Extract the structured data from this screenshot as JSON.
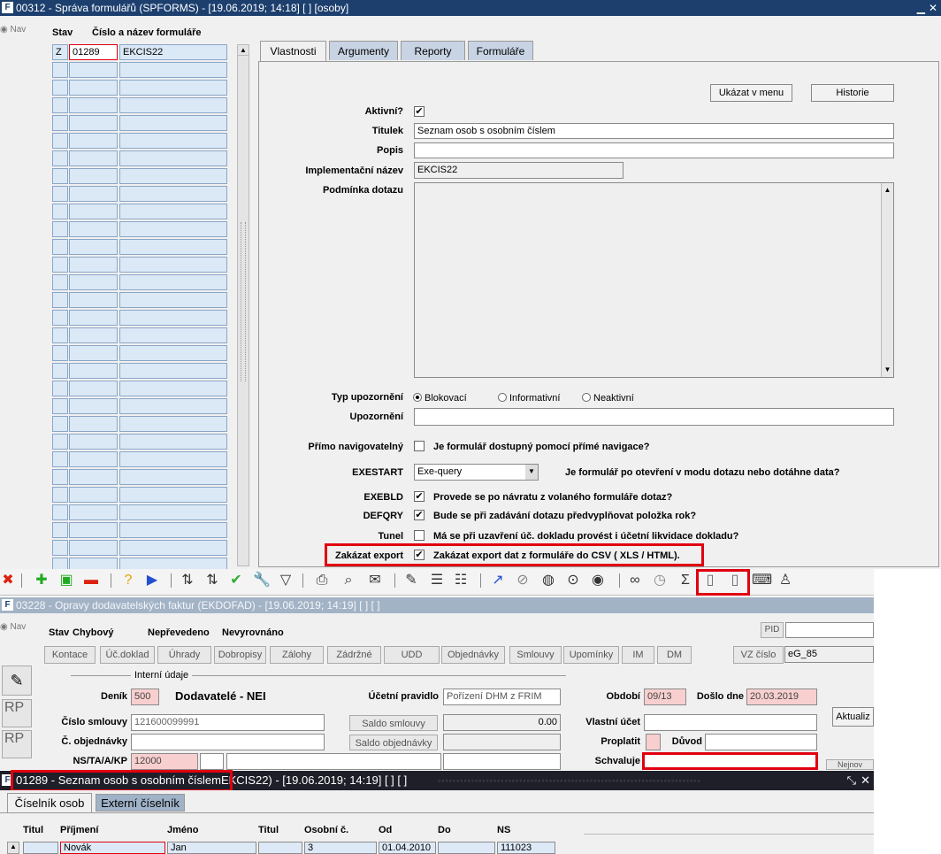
{
  "w1": {
    "title": "00312 - Správa formulářů (SPFORMS) - [19.06.2019; 14:18]  [ ]  [osoby]",
    "nav": "Nav",
    "col_stav": "Stav",
    "col_cislo": "Číslo a název formuláře",
    "row1": {
      "stav": "Z",
      "cislo": "01289",
      "nazev": "EKCIS22"
    },
    "tabs": [
      "Vlastnosti",
      "Argumenty",
      "Reporty",
      "Formuláře"
    ],
    "btn_menu": "Ukázat v menu",
    "btn_hist": "Historie",
    "lbl_aktivni": "Aktivní?",
    "lbl_titulek": "Titulek",
    "val_titulek": "Seznam osob s osobním číslem",
    "lbl_popis": "Popis",
    "lbl_impl": "Implementační název",
    "val_impl": "EKCIS22",
    "lbl_podminka": "Podmínka dotazu",
    "lbl_typ": "Typ upozornění",
    "radio_blok": "Blokovací",
    "radio_info": "Informativní",
    "radio_neakt": "Neaktivní",
    "lbl_upoz": "Upozornění",
    "lbl_primo": "Přímo navigovatelný",
    "txt_primo": "Je formulář dostupný pomocí přímé navigace?",
    "lbl_exestart": "EXESTART",
    "val_exestart": "Exe-query",
    "txt_exestart": "Je formulář po otevření v modu dotazu nebo dotáhne data?",
    "lbl_exebld": "EXEBLD",
    "txt_exebld": "Provede se po návratu z volaného formuláře dotaz?",
    "lbl_defqry": "DEFQRY",
    "txt_defqry": "Bude se při zadávání dotazu předvyplňovat položka rok?",
    "lbl_tunel": "Tunel",
    "txt_tunel": "Má se při uzavření úč. dokladu provést i účetní likvidace dokladu?",
    "lbl_zakazat": "Zakázat export",
    "txt_zakazat": "Zakázat export dat z formuláře do CSV ( XLS / HTML)."
  },
  "toolbar": {
    "icons": [
      "close-icon",
      "add-icon",
      "save-icon",
      "delete-icon",
      "help-icon",
      "run-icon",
      "sort-asc-icon",
      "sort-desc-icon",
      "check-icon",
      "wrench-icon",
      "filter-icon",
      "print-icon",
      "print-preview-icon",
      "mail-icon",
      "edit-icon",
      "list-icon",
      "checklist-icon",
      "export-link-icon",
      "attach-icon",
      "globe-icon",
      "compass-icon",
      "eye-icon",
      "glasses-icon",
      "clock-icon",
      "sum-icon",
      "xls-export-icon",
      "html-export-icon",
      "keyboard-icon",
      "reader-icon"
    ]
  },
  "w2": {
    "title": "03228 - Opravy dodavatelských faktur (EKDOFAD) - [19.06.2019; 14:19]  [ ]  [ ]",
    "nav": "Nav",
    "lbl_stav": "Stav",
    "stav_vals": [
      "Chybový",
      "Nepřevedeno",
      "Nevyrovnáno"
    ],
    "pid": "PID",
    "buttons": [
      "Kontace",
      "Úč.doklad",
      "Úhrady",
      "Dobropisy",
      "Zálohy",
      "Zádržné",
      "UDD",
      "Objednávky",
      "Smlouvy",
      "Upomínky",
      "IM",
      "DM"
    ],
    "vz_btn": "VZ číslo",
    "vz_val": "eG_85",
    "interni": "Interní údaje",
    "lbl_denik": "Deník",
    "val_denik": "500",
    "txt_dodavatele": "Dodavatelé - NEI",
    "lbl_ucetni": "Účetní pravidlo",
    "val_ucetni": "Pořízení DHM z FRIM",
    "lbl_obdobi": "Období",
    "val_obdobi": "09/13",
    "lbl_doslo": "Došlo dne",
    "val_doslo": "20.03.2019",
    "lbl_smlouvy": "Číslo smlouvy",
    "val_smlouvy": "121600099991",
    "btn_saldo_sml": "Saldo smlouvy",
    "val_saldo": "0.00",
    "lbl_vlastni": "Vlastní účet",
    "btn_aktual": "Aktualiz",
    "lbl_objednavky": "Č. objednávky",
    "btn_saldo_obj": "Saldo objednávky",
    "lbl_proplatit": "Proplatit",
    "lbl_duvod": "Důvod",
    "lbl_ns": "NS/TA/A/KP",
    "val_ns": "12000",
    "lbl_schvaluje": "Schvaluje",
    "btn_nejnov": "Nejnov"
  },
  "w3": {
    "title_hl": "01289 - Seznam osob s osobním číslem",
    "title_rest": "EKCIS22) - [19.06.2019; 14:19]  [ ]  [ ]",
    "tabs": [
      "Číselník osob",
      "Externí číselník"
    ],
    "cols": [
      "Titul",
      "Příjmení",
      "Jméno",
      "Titul",
      "Osobní č.",
      "Od",
      "Do",
      "NS"
    ],
    "row": [
      "",
      "Novák",
      "Jan",
      "",
      "3",
      "01.04.2010",
      "",
      "111023"
    ]
  }
}
